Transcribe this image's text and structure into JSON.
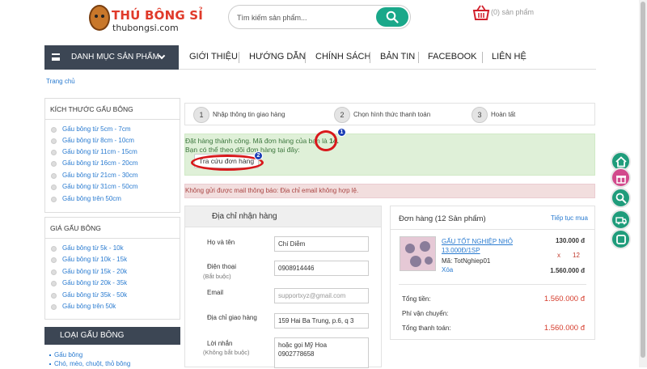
{
  "header": {
    "logo_name": "THÚ BÔNG SỈ",
    "logo_domain": "thubongsi.com",
    "search_placeholder": "Tìm kiếm sản phẩm...",
    "cart_text": "(0) sản phẩm"
  },
  "nav": {
    "category_label": "DANH MỤC SẢN PHẨM",
    "menu": [
      "GIỚI THIỆU",
      "HƯỚNG DẪN",
      "CHÍNH SÁCH",
      "BẢN TIN",
      "FACEBOOK",
      "LIÊN HỆ"
    ]
  },
  "breadcrumb": "Trang chủ",
  "sidebar": {
    "size": {
      "title": "KÍCH THƯỚC GẤU BÔNG",
      "items": [
        "Gấu bông từ 5cm - 7cm",
        "Gấu bông từ 8cm - 10cm",
        "Gấu bông từ 11cm - 15cm",
        "Gấu bông từ 16cm - 20cm",
        "Gấu bông từ 21cm - 30cm",
        "Gấu bông từ 31cm - 50cm",
        "Gấu bông trên 50cm"
      ]
    },
    "price": {
      "title": "GIÁ GẤU BÔNG",
      "items": [
        "Gấu bông từ 5k - 10k",
        "Gấu bông từ 10k - 15k",
        "Gấu bông từ 15k - 20k",
        "Gấu bông từ 20k - 35k",
        "Gấu bông từ 35k - 50k",
        "Gấu bông trên 50k"
      ]
    },
    "types": {
      "title": "LOẠI GẤU BÔNG",
      "items": [
        "Gấu bông",
        "Chó, mèo, chuột, thỏ bông"
      ]
    }
  },
  "steps": [
    {
      "num": "1",
      "label": "Nhập thông tin giao hàng"
    },
    {
      "num": "2",
      "label": "Chọn hình thức thanh toán"
    },
    {
      "num": "3",
      "label": "Hoàn tất"
    }
  ],
  "success": {
    "line1_prefix": "Đặt hàng thành công. Mã đơn hàng của bạn là ",
    "order_code": "14.",
    "line2": "Bạn có thể theo dõi đơn hàng tại đây:",
    "track_button": "Tra cứu đơn hàng",
    "badge1": "1",
    "badge2": "2"
  },
  "error_message": "Không gửi được mail thông báo: Địa chỉ email không hợp lệ.",
  "address": {
    "title": "Địa chỉ nhận hàng",
    "name_label": "Họ và tên",
    "name_value": "Chí Diễm",
    "phone_label": "Điện thoại",
    "phone_note": "(Bắt buộc)",
    "phone_value": "0908914446",
    "email_label": "Email",
    "email_placeholder": "supportxyz@gmail.com",
    "addr_label": "Địa chỉ giao hàng",
    "addr_value": "159 Hai Ba Trung, p.6, q 3",
    "msg_label": "Lời nhắn",
    "msg_note": "(Không bắt buộc)",
    "msg_line1": "hoặc gọi Mỹ Hoa",
    "msg_line2": "0902778658"
  },
  "order": {
    "title": "Đơn hàng (12 Sản phẩm)",
    "continue_label": "Tiếp tục mua",
    "product": {
      "name": "GẤU TỐT NGHIỆP NHỎ 13.000Đ/1SP",
      "code": "Mã: TotNghiep01",
      "delete": "Xóa",
      "price": "130.000 đ",
      "x": "x",
      "qty": "12",
      "subtotal": "1.560.000 đ"
    },
    "subtotal_label": "Tổng tiền:",
    "subtotal_value": "1.560.000 đ",
    "shipping_label": "Phí vận chuyển:",
    "total_label": "Tổng thanh toán:",
    "total_value": "1.560.000 đ"
  },
  "float_icons": [
    "home-icon",
    "gift-icon",
    "search-icon",
    "truck-icon",
    "chat-icon"
  ],
  "colors": {
    "accent": "#1aa88a",
    "nav_dark": "#3c4654",
    "link": "#2a7bd0",
    "price_red": "#d53c2c",
    "annotation": "#d8181b"
  }
}
